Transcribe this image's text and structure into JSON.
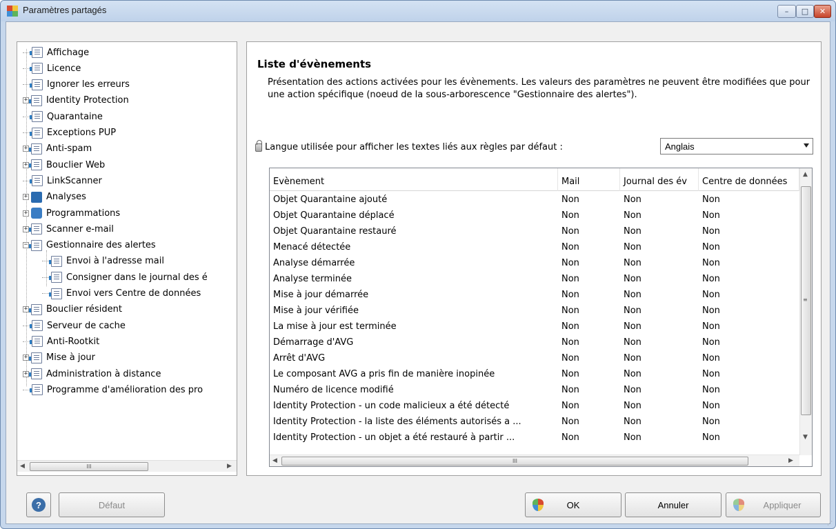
{
  "window": {
    "title": "Paramètres partagés",
    "controls": {
      "minimize": "–",
      "maximize": "□",
      "close": "✕"
    }
  },
  "tree": {
    "items": [
      {
        "label": "Affichage",
        "level": 0,
        "expander": "",
        "icon": "document-icon"
      },
      {
        "label": "Licence",
        "level": 0,
        "expander": "",
        "icon": "document-icon"
      },
      {
        "label": "Ignorer les erreurs",
        "level": 0,
        "expander": "",
        "icon": "document-icon"
      },
      {
        "label": "Identity Protection",
        "level": 0,
        "expander": "+",
        "icon": "document-icon"
      },
      {
        "label": "Quarantaine",
        "level": 0,
        "expander": "",
        "icon": "document-icon"
      },
      {
        "label": "Exceptions PUP",
        "level": 0,
        "expander": "",
        "icon": "document-icon"
      },
      {
        "label": "Anti-spam",
        "level": 0,
        "expander": "+",
        "icon": "document-icon"
      },
      {
        "label": "Bouclier Web",
        "level": 0,
        "expander": "+",
        "icon": "document-icon"
      },
      {
        "label": "LinkScanner",
        "level": 0,
        "expander": "",
        "icon": "document-icon"
      },
      {
        "label": "Analyses",
        "level": 0,
        "expander": "+",
        "icon": "scan-icon"
      },
      {
        "label": "Programmations",
        "level": 0,
        "expander": "+",
        "icon": "schedule-icon"
      },
      {
        "label": "Scanner e-mail",
        "level": 0,
        "expander": "+",
        "icon": "document-icon"
      },
      {
        "label": "Gestionnaire des alertes",
        "level": 0,
        "expander": "−",
        "icon": "document-icon"
      },
      {
        "label": "Envoi à l'adresse mail",
        "level": 1,
        "expander": "",
        "icon": "document-icon"
      },
      {
        "label": "Consigner dans le journal des é",
        "level": 1,
        "expander": "",
        "icon": "document-icon"
      },
      {
        "label": "Envoi vers Centre de données",
        "level": 1,
        "expander": "",
        "icon": "document-icon"
      },
      {
        "label": "Bouclier résident",
        "level": 0,
        "expander": "+",
        "icon": "document-icon"
      },
      {
        "label": "Serveur de cache",
        "level": 0,
        "expander": "",
        "icon": "document-icon"
      },
      {
        "label": "Anti-Rootkit",
        "level": 0,
        "expander": "",
        "icon": "document-icon"
      },
      {
        "label": "Mise à jour",
        "level": 0,
        "expander": "+",
        "icon": "document-icon"
      },
      {
        "label": "Administration à distance",
        "level": 0,
        "expander": "+",
        "icon": "document-icon"
      },
      {
        "label": "Programme d'amélioration des pro",
        "level": 0,
        "expander": "",
        "icon": "document-icon"
      }
    ],
    "scroll_grip": "III"
  },
  "main": {
    "section_title": "Liste d'évènements",
    "description": "Présentation des actions activées pour les évènements.  Les valeurs des paramètres ne peuvent être modifiées que pour une action spécifique (noeud de la sous-arborescence \"Gestionnaire des alertes\").",
    "language_label": "Langue utilisée pour afficher les textes liés aux règles par défaut :",
    "language_value": "Anglais"
  },
  "table": {
    "columns": [
      "Evènement",
      "Mail",
      "Journal des év",
      "Centre de données"
    ],
    "rows": [
      [
        "Objet Quarantaine ajouté",
        "Non",
        "Non",
        "Non"
      ],
      [
        "Objet Quarantaine déplacé",
        "Non",
        "Non",
        "Non"
      ],
      [
        "Objet Quarantaine restauré",
        "Non",
        "Non",
        "Non"
      ],
      [
        "Menacé détectée",
        "Non",
        "Non",
        "Non"
      ],
      [
        "Analyse démarrée",
        "Non",
        "Non",
        "Non"
      ],
      [
        "Analyse terminée",
        "Non",
        "Non",
        "Non"
      ],
      [
        "Mise à jour démarrée",
        "Non",
        "Non",
        "Non"
      ],
      [
        "Mise à jour vérifiée",
        "Non",
        "Non",
        "Non"
      ],
      [
        "La mise à jour est terminée",
        "Non",
        "Non",
        "Non"
      ],
      [
        "Démarrage d'AVG",
        "Non",
        "Non",
        "Non"
      ],
      [
        "Arrêt d'AVG",
        "Non",
        "Non",
        "Non"
      ],
      [
        "Le composant AVG a pris fin de manière inopinée",
        "Non",
        "Non",
        "Non"
      ],
      [
        "Numéro de licence modifié",
        "Non",
        "Non",
        "Non"
      ],
      [
        "Identity Protection - un code malicieux a été détecté",
        "Non",
        "Non",
        "Non"
      ],
      [
        "Identity Protection - la liste des éléments autorisés a ...",
        "Non",
        "Non",
        "Non"
      ],
      [
        "Identity Protection - un objet a été restauré à partir ...",
        "Non",
        "Non",
        "Non"
      ]
    ],
    "scroll_grip": "III",
    "vgrip": "≡"
  },
  "buttons": {
    "help": "?",
    "default": "Défaut",
    "ok": "OK",
    "cancel": "Annuler",
    "apply": "Appliquer"
  },
  "colors": {
    "accent": "#3b6ea8",
    "titlebar": "#c6d7ec",
    "close_button": "#c7442a"
  }
}
